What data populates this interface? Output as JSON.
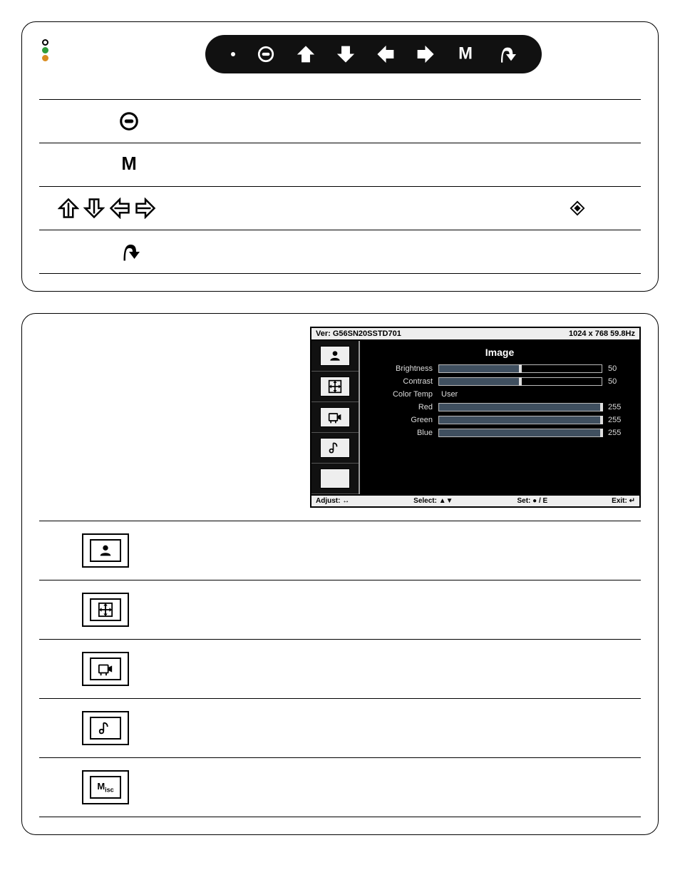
{
  "top_panel": {
    "buttons": [
      "power",
      "up",
      "down",
      "left",
      "right",
      "menu",
      "exit"
    ],
    "key_rows": [
      {
        "icons": [
          "power"
        ],
        "right_icon": null
      },
      {
        "icons": [
          "menu-m"
        ],
        "right_icon": null
      },
      {
        "icons": [
          "up",
          "down",
          "left",
          "right"
        ],
        "right_icon": "diamond"
      },
      {
        "icons": [
          "exit"
        ],
        "right_icon": null
      }
    ]
  },
  "osd": {
    "version": "Ver: G56SN20SSTD701",
    "resolution": "1024 x 768  59.8Hz",
    "tabs": [
      "image",
      "geometry",
      "video-input",
      "audio",
      "misc"
    ],
    "title": "Image",
    "items": [
      {
        "label": "Brightness",
        "type": "slider",
        "value": 50,
        "max": 100
      },
      {
        "label": "Contrast",
        "type": "slider",
        "value": 50,
        "max": 100
      },
      {
        "label": "Color Temp",
        "type": "text",
        "value": "User"
      },
      {
        "label": "Red",
        "type": "slider",
        "value": 255,
        "max": 255
      },
      {
        "label": "Green",
        "type": "slider",
        "value": 255,
        "max": 255
      },
      {
        "label": "Blue",
        "type": "slider",
        "value": 255,
        "max": 255
      }
    ],
    "footer": {
      "adjust": "Adjust: ↔",
      "select": "Select: ▲▼",
      "set": "Set: ● / E",
      "exit": "Exit: ↵"
    }
  },
  "menu_rows": [
    {
      "id": "image",
      "label": ""
    },
    {
      "id": "geometry",
      "label": ""
    },
    {
      "id": "video-input",
      "label": ""
    },
    {
      "id": "audio",
      "label": ""
    },
    {
      "id": "misc",
      "label": "Misc"
    }
  ]
}
